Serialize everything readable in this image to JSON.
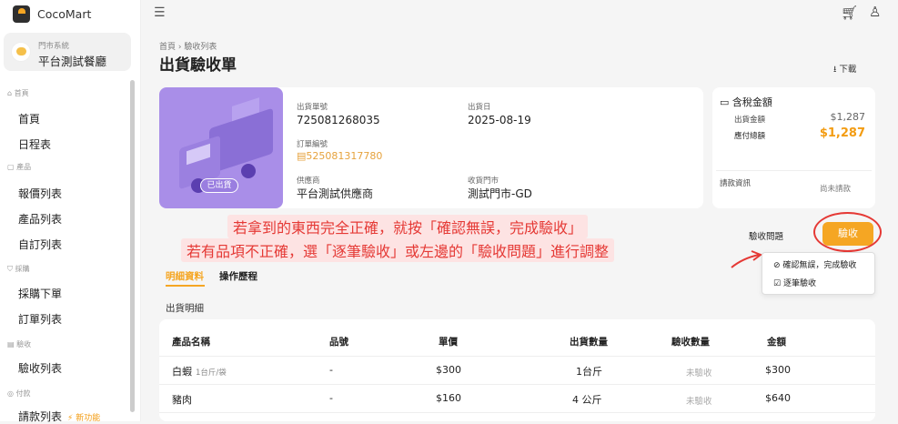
{
  "app": {
    "name": "CocoMart"
  },
  "store": {
    "system_label": "門市系統",
    "name": "平台測試餐廳"
  },
  "nav": {
    "cat_home": "首頁",
    "home": "首頁",
    "schedule": "日程表",
    "cat_product": "產品",
    "quote_list": "報價列表",
    "product_list": "產品列表",
    "custom_list": "自訂列表",
    "cat_purchase": "採購",
    "purchase_order": "採購下單",
    "order_list": "訂單列表",
    "cat_receive": "驗收",
    "receive_list": "驗收列表",
    "cat_pay": "付款",
    "payment_list": "請款列表",
    "new_feature": "⚡ 新功能"
  },
  "breadcrumb": {
    "home": "首頁",
    "sep": "›",
    "current": "驗收列表"
  },
  "page": {
    "title": "出貨驗收單",
    "download": "下載"
  },
  "shipment": {
    "badge": "已出貨",
    "no_label": "出貨單號",
    "no": "725081268035",
    "date_label": "出貨日",
    "date": "2025-08-19",
    "order_label": "訂單編號",
    "order_no": "525081317780",
    "supplier_label": "供應商",
    "supplier": "平台測試供應商",
    "store_label": "收貨門市",
    "store": "測試門市-GD"
  },
  "tax": {
    "title": "含稅金額",
    "ship_amount_label": "出貨金額",
    "ship_amount": "$1,287",
    "payable_label": "應付總額",
    "payable": "$1,287",
    "billing_label": "請款資訊",
    "billing_status": "尚未請款"
  },
  "annotation": {
    "line1": "若拿到的東西完全正確，就按「確認無誤，完成驗收」",
    "line2": "若有品項不正確，選「逐筆驗收」或左邊的「驗收問題」進行調整"
  },
  "actions": {
    "issue": "驗收問題",
    "accept": "驗收",
    "confirm_all": "確認無誤，完成驗收",
    "item_by_item": "逐筆驗收"
  },
  "tabs": {
    "detail": "明細資料",
    "history": "操作歷程"
  },
  "section": {
    "title": "出貨明細"
  },
  "table": {
    "headers": [
      "產品名稱",
      "品號",
      "單價",
      "出貨數量",
      "驗收數量",
      "金額"
    ],
    "rows": [
      {
        "name": "白蝦",
        "unit": "1台斤/袋",
        "sku": "-",
        "price": "$300",
        "qty": "1台斤",
        "received": "未驗收",
        "amount": "$300"
      },
      {
        "name": "豬肉",
        "unit": "",
        "sku": "-",
        "price": "$160",
        "qty": "4 公斤",
        "received": "未驗收",
        "amount": "$640"
      }
    ]
  },
  "colors": {
    "accent": "#f5a623",
    "annotation": "#e53935"
  }
}
